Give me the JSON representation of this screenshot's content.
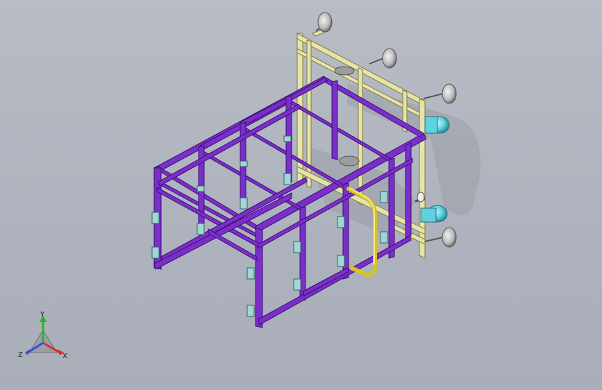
{
  "viewport": {
    "background_top": "#b7bcc5",
    "background_bottom": "#a9aeb8"
  },
  "model": {
    "frame_color": "#7a2fc8",
    "frame_dark": "#4c1590",
    "rack_color": "#e6e3a8",
    "rack_dark": "#9a9660",
    "handle_color": "#f2e04a",
    "wheel_color": "#5fd0e0",
    "pad_color": "#c8c8c8",
    "shadow_color": "#8e929b"
  },
  "triad": {
    "x_label": "X",
    "y_label": "Y",
    "z_label": "Z",
    "x_color": "#d23030",
    "y_color": "#2fb12f",
    "z_color": "#3050d8"
  }
}
